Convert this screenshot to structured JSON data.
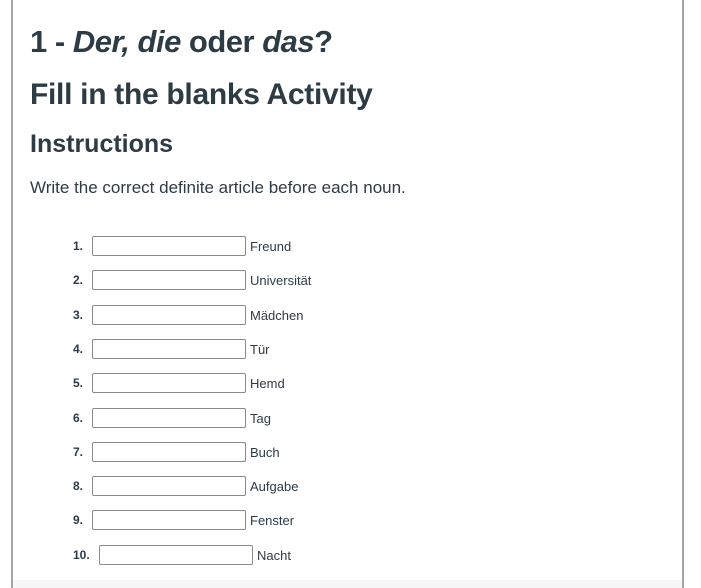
{
  "title": {
    "number": "1",
    "separator": " - ",
    "part1_italic": "Der, die",
    "part2": " oder ",
    "part3_italic": "das",
    "part4": "?"
  },
  "subtitle": "Fill in the blanks Activity",
  "instructions": {
    "heading": "Instructions",
    "text": "Write the correct definite article before each noun."
  },
  "items": [
    {
      "number": "1.",
      "value": "",
      "noun": "Freund"
    },
    {
      "number": "2.",
      "value": "",
      "noun": "Universität"
    },
    {
      "number": "3.",
      "value": "",
      "noun": "Mädchen"
    },
    {
      "number": "4.",
      "value": "",
      "noun": "Tür"
    },
    {
      "number": "5.",
      "value": "",
      "noun": "Hemd"
    },
    {
      "number": "6.",
      "value": "",
      "noun": "Tag"
    },
    {
      "number": "7.",
      "value": "",
      "noun": "Buch"
    },
    {
      "number": "8.",
      "value": "",
      "noun": "Aufgabe"
    },
    {
      "number": "9.",
      "value": "",
      "noun": "Fenster"
    },
    {
      "number": "10.",
      "value": "",
      "noun": "Nacht"
    }
  ]
}
